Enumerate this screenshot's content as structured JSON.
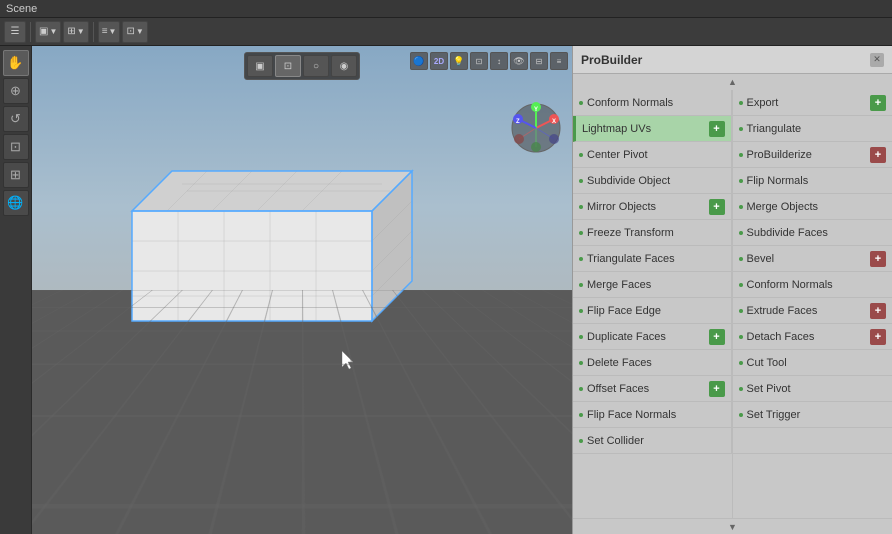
{
  "window": {
    "title": "Scene"
  },
  "toolbar": {
    "buttons": [
      "☰",
      "▣",
      "⊞",
      "≡",
      "⋯"
    ]
  },
  "viewport_buttons": [
    {
      "label": "▣",
      "id": "perspective",
      "active": false
    },
    {
      "label": "⊡",
      "id": "wireframe",
      "active": false
    },
    {
      "label": "○",
      "id": "shaded",
      "active": false
    },
    {
      "label": "◉",
      "id": "textured",
      "active": true
    }
  ],
  "probuilder": {
    "title": "ProBuilder",
    "scroll_up": "▲",
    "scroll_down": "▼",
    "items_left": [
      {
        "label": "Conform Normals",
        "highlighted": false,
        "dot": true,
        "plus": false
      },
      {
        "label": "Lightmap UVs",
        "highlighted": true,
        "dot": false,
        "plus": true
      },
      {
        "label": "Center Pivot",
        "highlighted": false,
        "dot": true,
        "plus": false
      },
      {
        "label": "Subdivide Object",
        "highlighted": false,
        "dot": true,
        "plus": false
      },
      {
        "label": "Mirror Objects",
        "highlighted": false,
        "dot": true,
        "plus": true
      },
      {
        "label": "Freeze Transform",
        "highlighted": false,
        "dot": true,
        "plus": false
      },
      {
        "label": "Triangulate Faces",
        "highlighted": false,
        "dot": true,
        "plus": false
      },
      {
        "label": "Merge Faces",
        "highlighted": false,
        "dot": true,
        "plus": false
      },
      {
        "label": "Flip Face Edge",
        "highlighted": false,
        "dot": true,
        "plus": false
      },
      {
        "label": "Duplicate Faces",
        "highlighted": false,
        "dot": true,
        "plus": true
      },
      {
        "label": "Delete Faces",
        "highlighted": false,
        "dot": true,
        "plus": false
      },
      {
        "label": "Offset Faces",
        "highlighted": false,
        "dot": true,
        "plus": true
      },
      {
        "label": "Flip Face Normals",
        "highlighted": false,
        "dot": true,
        "plus": false
      },
      {
        "label": "Set Collider",
        "highlighted": false,
        "dot": true,
        "plus": false
      }
    ],
    "items_right": [
      {
        "label": "Export",
        "highlighted": false,
        "dot": true,
        "plus": true
      },
      {
        "label": "Triangulate",
        "highlighted": false,
        "dot": true,
        "plus": false
      },
      {
        "label": "ProBuilderize",
        "highlighted": false,
        "dot": true,
        "plus": true
      },
      {
        "label": "Flip Normals",
        "highlighted": false,
        "dot": true,
        "plus": false
      },
      {
        "label": "Merge Objects",
        "highlighted": false,
        "dot": true,
        "plus": false
      },
      {
        "label": "Subdivide Faces",
        "highlighted": false,
        "dot": true,
        "plus": false
      },
      {
        "label": "Bevel",
        "highlighted": false,
        "dot": true,
        "plus": true
      },
      {
        "label": "Conform Normals",
        "highlighted": false,
        "dot": true,
        "plus": false
      },
      {
        "label": "Extrude Faces",
        "highlighted": false,
        "dot": true,
        "plus": true
      },
      {
        "label": "Detach Faces",
        "highlighted": false,
        "dot": true,
        "plus": true
      },
      {
        "label": "Cut Tool",
        "highlighted": false,
        "dot": true,
        "plus": false
      },
      {
        "label": "Set Pivot",
        "highlighted": false,
        "dot": true,
        "plus": false
      },
      {
        "label": "Set Trigger",
        "highlighted": false,
        "dot": true,
        "plus": false
      },
      {
        "label": "",
        "highlighted": false,
        "dot": false,
        "plus": false
      }
    ]
  },
  "left_tools": [
    "✋",
    "⊕",
    "↺",
    "⊡",
    "⊞",
    "🌐"
  ],
  "top_toolbar_items": [
    {
      "label": "≡",
      "type": "btn"
    },
    {
      "label": "▣▼",
      "type": "dropdown"
    },
    {
      "label": "⊞▼",
      "type": "dropdown"
    },
    {
      "label": "≡▼",
      "type": "dropdown"
    },
    {
      "label": "⊡▼",
      "type": "dropdown"
    }
  ],
  "viewport_top_right": [
    "🔵",
    "2D",
    "💡",
    "⊡",
    "↕",
    "👁",
    "⊟",
    "≡"
  ],
  "colors": {
    "sky_top": "#87a8c4",
    "sky_bottom": "#b0b8bc",
    "floor": "#5a5a5a",
    "highlight_green": "#a8d4a8",
    "accent_green": "#4a9a4a",
    "accent_red": "#9a4a4a",
    "panel_bg": "#c8c8c8"
  }
}
